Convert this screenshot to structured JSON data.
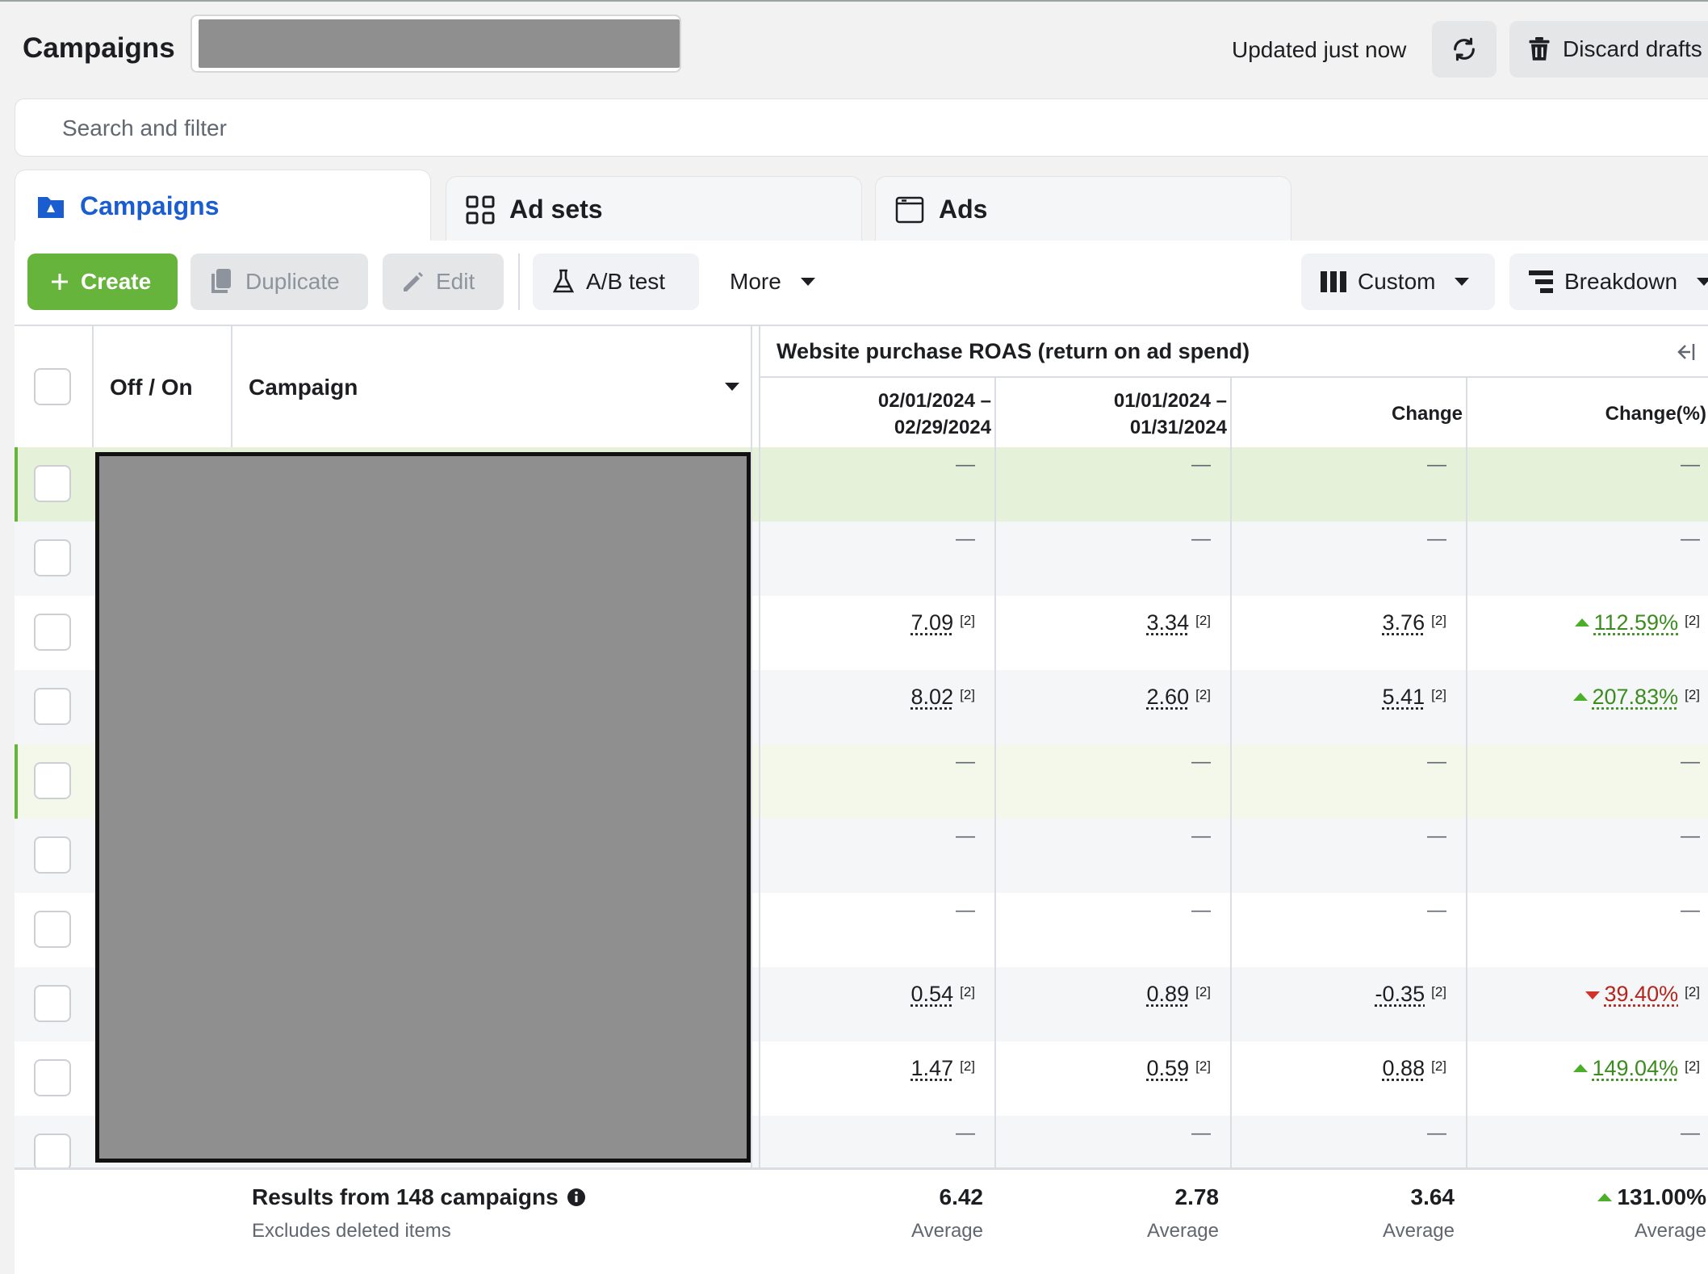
{
  "header": {
    "title": "Campaigns",
    "updated": "Updated just now",
    "discard_label": "Discard drafts"
  },
  "search": {
    "placeholder": "Search and filter"
  },
  "tabs": [
    {
      "label": "Campaigns",
      "active": true
    },
    {
      "label": "Ad sets",
      "active": false
    },
    {
      "label": "Ads",
      "active": false
    }
  ],
  "toolbar": {
    "create": "Create",
    "duplicate": "Duplicate",
    "edit": "Edit",
    "ab_test": "A/B test",
    "more": "More",
    "custom": "Custom",
    "breakdown": "Breakdown"
  },
  "table": {
    "col_offon": "Off / On",
    "col_campaign": "Campaign",
    "group_header": "Website purchase ROAS (return on ad spend)",
    "col_period1": "02/01/2024 –\n02/29/2024",
    "col_period2": "01/01/2024 –\n01/31/2024",
    "col_change": "Change",
    "col_change_pct": "Change(%)",
    "note_marker": "[2]",
    "dash": "—",
    "rows": [
      {
        "p1": "—",
        "p2": "—",
        "change": "—",
        "pct": "—",
        "style": "green"
      },
      {
        "p1": "—",
        "p2": "—",
        "change": "—",
        "pct": "—",
        "style": "b"
      },
      {
        "p1": "7.09",
        "p2": "3.34",
        "change": "3.76",
        "pct": "112.59%",
        "dir": "up",
        "style": "a"
      },
      {
        "p1": "8.02",
        "p2": "2.60",
        "change": "5.41",
        "pct": "207.83%",
        "dir": "up",
        "style": "b"
      },
      {
        "p1": "—",
        "p2": "—",
        "change": "—",
        "pct": "—",
        "style": "green-light"
      },
      {
        "p1": "—",
        "p2": "—",
        "change": "—",
        "pct": "—",
        "style": "b"
      },
      {
        "p1": "—",
        "p2": "—",
        "change": "—",
        "pct": "—",
        "style": "a"
      },
      {
        "p1": "0.54",
        "p2": "0.89",
        "change": "-0.35",
        "pct": "39.40%",
        "dir": "down",
        "style": "b"
      },
      {
        "p1": "1.47",
        "p2": "0.59",
        "change": "0.88",
        "pct": "149.04%",
        "dir": "up",
        "style": "a"
      },
      {
        "p1": "—",
        "p2": "—",
        "change": "—",
        "pct": "—",
        "style": "b"
      }
    ]
  },
  "footer": {
    "results": "Results from 148 campaigns",
    "excludes": "Excludes deleted items",
    "p1": "6.42",
    "p2": "2.78",
    "change": "3.64",
    "pct": "131.00%",
    "average": "Average"
  },
  "colors": {
    "accent_blue": "#1a5dd0",
    "create_green": "#66b43b",
    "positive": "#3b8c1e",
    "negative": "#b3261e"
  }
}
